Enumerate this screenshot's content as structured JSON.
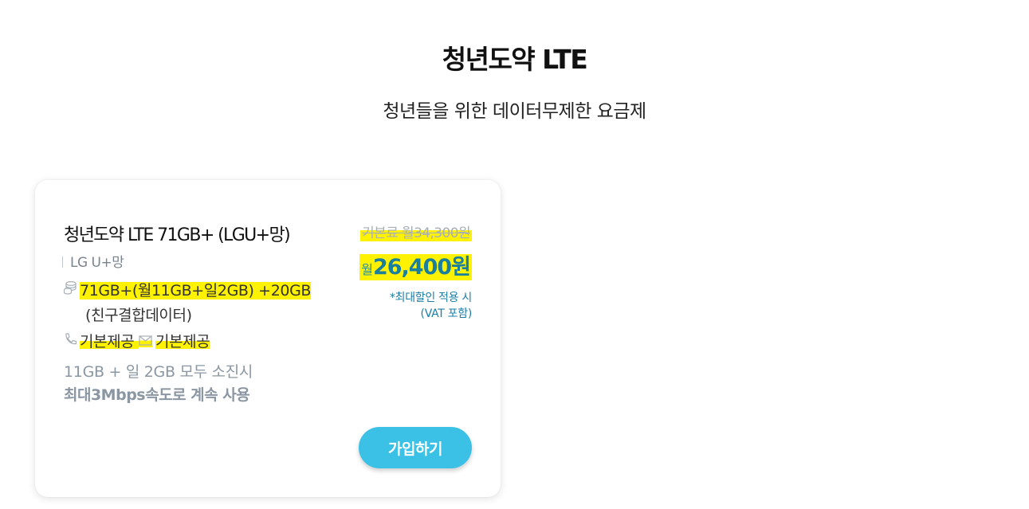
{
  "header": {
    "title": "청년도약 LTE",
    "subtitle": "청년들을 위한 데이터무제한 요금제"
  },
  "plan": {
    "name": "청년도약 LTE 71GB+ (LGU+망)",
    "carrier": "LG U+망",
    "data": "71GB+(월11GB+일2GB) +20GB",
    "data_extra": "(친구결합데이터)",
    "voice": "기본제공",
    "sms": "기본제공",
    "note_line1": "11GB + 일 2GB 모두 소진시",
    "note_line2": "최대3Mbps속도로 계속 사용",
    "original_price": "기본료 월34,300원",
    "sale_prefix": "월",
    "sale_amount": "26,400원",
    "discount_note1": "*최대할인 적용 시",
    "discount_note2": "(VAT 포함)",
    "join_label": "가입하기",
    "icons": {
      "data": "database-stack-icon",
      "voice": "phone-icon",
      "sms": "envelope-icon"
    },
    "colors": {
      "accent": "#3cc1e6",
      "price": "#1a7f9e",
      "highlight": "#fff200"
    }
  }
}
